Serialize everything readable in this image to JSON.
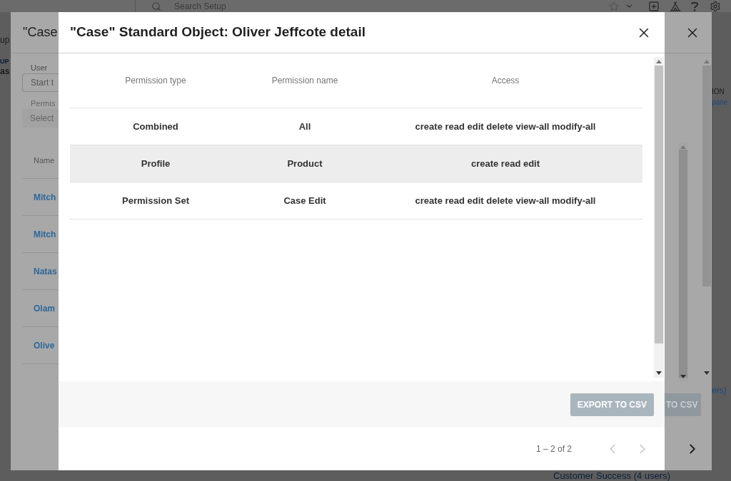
{
  "background": {
    "search": {
      "placeholder": "Search Setup"
    },
    "left_fragments": [
      "up",
      "UP",
      "as"
    ],
    "right_fragments": [
      {
        "text": "ION",
        "kind": "label"
      },
      {
        "text": "pane",
        "kind": "link"
      },
      {
        "text": "ers)",
        "kind": "link"
      }
    ],
    "bottom_link": "Customer Success (4 users)"
  },
  "back_dialog": {
    "title": "\"Case",
    "user_label": "User",
    "user_field": {
      "placeholder": "Start t"
    },
    "permission_label": "Permis",
    "permission_field": {
      "placeholder": "Select"
    },
    "name_header": "Name",
    "names": [
      "Mitch",
      "Mitch",
      "Natas",
      "Olam",
      "Olive"
    ],
    "export_button": "TO CSV"
  },
  "dialog": {
    "title": "\"Case\" Standard Object: Oliver Jeffcote detail",
    "table": {
      "columns": [
        "Permission type",
        "Permission name",
        "Access"
      ],
      "rows": [
        {
          "hovered": false,
          "cells": [
            "Combined",
            "All",
            "create read edit delete view-all modify-all"
          ]
        },
        {
          "hovered": true,
          "cells": [
            "Profile",
            "Product",
            "create read edit"
          ]
        },
        {
          "hovered": false,
          "cells": [
            "Permission Set",
            "Case Edit",
            "create read edit delete view-all modify-all"
          ]
        }
      ]
    },
    "export_button": {
      "label": "EXPORT TO CSV",
      "disabled": true
    },
    "pagination": {
      "range": "1 – 2 of 2",
      "prev_disabled": true,
      "next_disabled": true
    }
  }
}
